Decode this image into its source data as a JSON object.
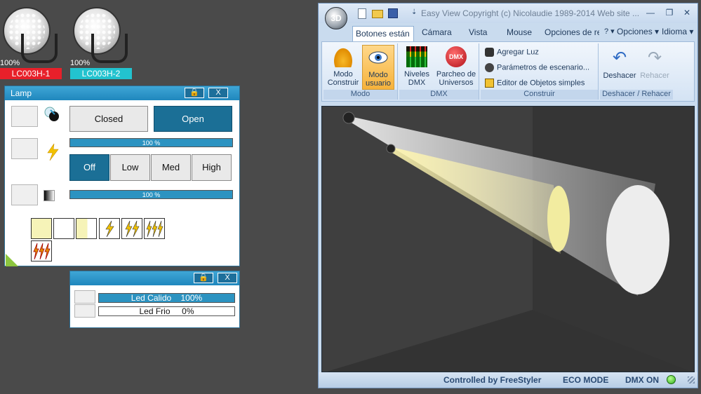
{
  "fixtures": [
    {
      "percent": "100%",
      "name": "LC003H-1",
      "color": "#e8202a"
    },
    {
      "percent": "100%",
      "name": "LC003H-2",
      "color": "#22c3cf"
    }
  ],
  "lamp_panel": {
    "title": "Lamp",
    "lock": "🔒",
    "close": "X",
    "shutter": {
      "closed": "Closed",
      "open": "Open"
    },
    "intensity_bar": {
      "value": 1.0,
      "label": "100 %"
    },
    "levels": [
      "Off",
      "Low",
      "Med",
      "High"
    ],
    "dimmer_bar": {
      "value": 1.0,
      "label": "100 %"
    }
  },
  "led_panel": {
    "lock": "🔒",
    "close": "X",
    "rows": [
      {
        "label": "Led Calido    100%",
        "value": 1.0
      },
      {
        "label": "Led Frio     0%",
        "value": 0.0
      }
    ]
  },
  "easyview": {
    "logo": "3D",
    "title": "Easy View   Copyright (c) Nicolaudie 1989-2014   Web site ...",
    "tabs": [
      "Botones están",
      "Cámara",
      "Vista",
      "Mouse",
      "Opciones de re",
      "? ▾",
      "Opciones ▾",
      "Idioma ▾"
    ],
    "groups": {
      "modo": {
        "name": "Modo",
        "build": "Modo\nConstruir",
        "user": "Modo\nusuario"
      },
      "dmx": {
        "name": "DMX",
        "levels": "Niveles\nDMX",
        "patch": "Parcheo de\nUniversos"
      },
      "construir": {
        "name": "Construir",
        "add_light": "Agregar Luz",
        "scene_params": "Parámetros de escenario...",
        "editor": "Editor de Objetos simples"
      },
      "undo": {
        "name": "Deshacer / Rehacer",
        "undo": "Deshacer",
        "redo": "Rehacer"
      }
    },
    "status": {
      "controlled": "Controlled by FreeStyler",
      "eco": "ECO MODE",
      "dmx": "DMX ON"
    }
  }
}
